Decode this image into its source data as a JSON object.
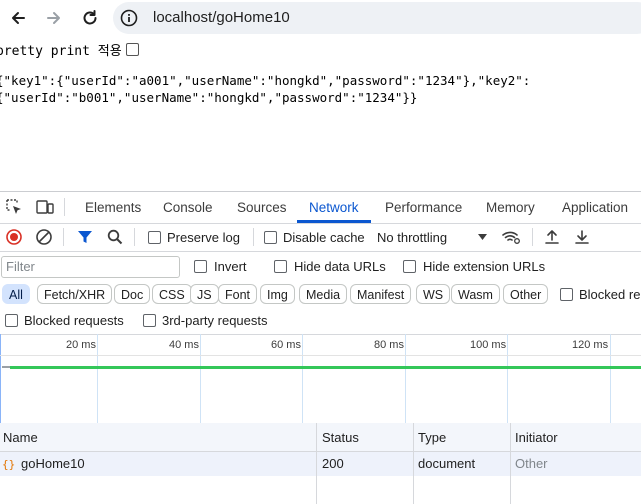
{
  "browser": {
    "url": "localhost/goHome10"
  },
  "page": {
    "pretty_print_label": "pretty print 적용",
    "json_line1": "{\"key1\":{\"userId\":\"a001\",\"userName\":\"hongkd\",\"password\":\"1234\"},\"key2\":",
    "json_line2": "{\"userId\":\"b001\",\"userName\":\"hongkd\",\"password\":\"1234\"}}"
  },
  "devtools": {
    "tabs": [
      "Elements",
      "Console",
      "Sources",
      "Network",
      "Performance",
      "Memory",
      "Application"
    ],
    "active_tab": "Network",
    "toolbar": {
      "preserve_log": "Preserve log",
      "disable_cache": "Disable cache",
      "throttling": "No throttling"
    },
    "filter": {
      "placeholder": "Filter",
      "invert": "Invert",
      "hide_data_urls": "Hide data URLs",
      "hide_extension_urls": "Hide extension URLs"
    },
    "type_filters": [
      "All",
      "Fetch/XHR",
      "Doc",
      "CSS",
      "JS",
      "Font",
      "Img",
      "Media",
      "Manifest",
      "WS",
      "Wasm",
      "Other"
    ],
    "blocked_response_cookies": "Blocked re",
    "blocked_requests": "Blocked requests",
    "third_party_requests": "3rd-party requests",
    "timeline_ticks": [
      "20 ms",
      "40 ms",
      "60 ms",
      "80 ms",
      "100 ms",
      "120 ms"
    ],
    "table": {
      "columns": [
        "Name",
        "Status",
        "Type",
        "Initiator"
      ],
      "rows": [
        {
          "name": "goHome10",
          "status": "200",
          "type": "document",
          "initiator": "Other"
        }
      ]
    }
  },
  "colors": {
    "accent": "#0b57d0",
    "record_red": "#d93025",
    "timeline_green": "#34c759"
  }
}
